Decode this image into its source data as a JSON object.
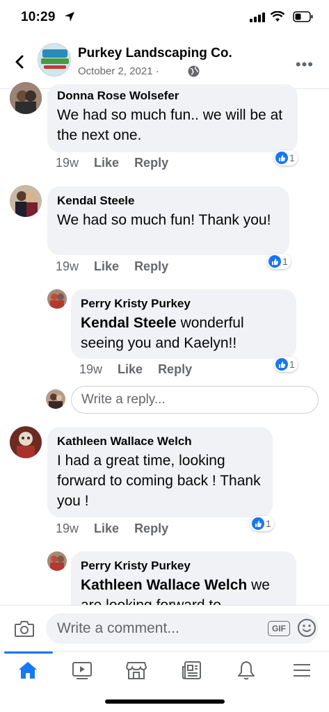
{
  "status_bar": {
    "time": "10:29"
  },
  "header": {
    "page_name": "Purkey Landscaping Co.",
    "date": "October 2, 2021 ·",
    "more": "•••"
  },
  "comments": [
    {
      "author": "Donna Rose Wolsefer",
      "text": "We had so much fun.. we will be at the next one.",
      "time": "19w",
      "like": "Like",
      "reply": "Reply",
      "reactions": "1"
    },
    {
      "author": "Kendal Steele",
      "text": "We had so much fun! Thank you!",
      "time": "19w",
      "like": "Like",
      "reply": "Reply",
      "reactions": "1"
    },
    {
      "author": "Perry Kristy Purkey",
      "mention": "Kendal Steele",
      "text": " wonderful seeing you and Kaelyn!!",
      "time": "19w",
      "like": "Like",
      "reply": "Reply",
      "reactions": "1"
    },
    {
      "author": "Kathleen Wallace Welch",
      "text": "I had a great time, looking forward to coming back ! Thank you !",
      "time": "19w",
      "like": "Like",
      "reply": "Reply",
      "reactions": "1"
    },
    {
      "author": "Perry Kristy Purkey",
      "mention": "Kathleen Wallace Welch",
      "text": " we are looking forward to"
    }
  ],
  "reply_box": {
    "placeholder": "Write a reply..."
  },
  "composer": {
    "placeholder": "Write a comment...",
    "gif": "GIF"
  },
  "tabs": [
    "home",
    "watch",
    "marketplace",
    "news",
    "notifications",
    "menu"
  ],
  "colors": {
    "accent": "#1877f2",
    "bubble": "#f0f2f5",
    "secondary_text": "#65676b"
  }
}
